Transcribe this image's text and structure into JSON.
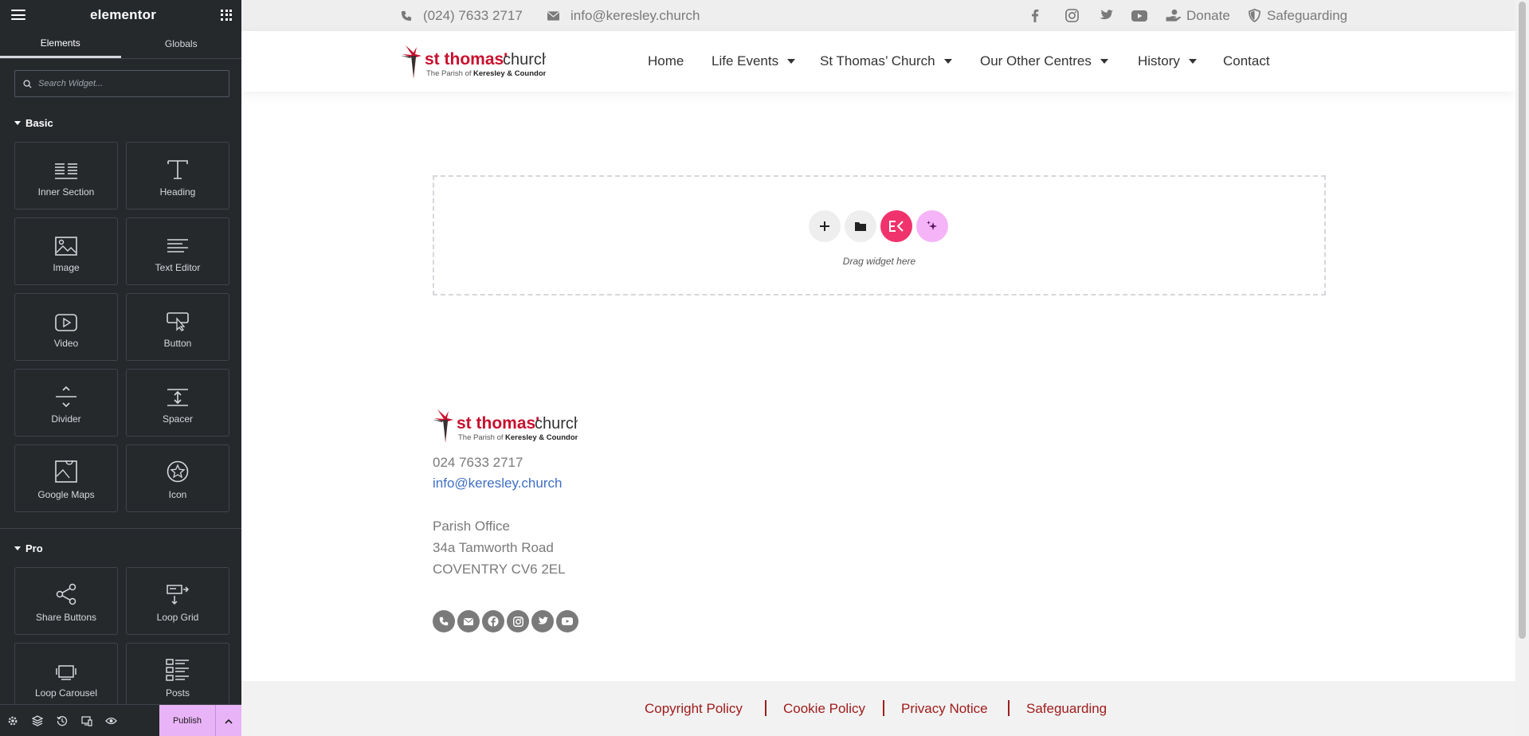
{
  "panel": {
    "brand": "elementor",
    "tabs": [
      {
        "label": "Elements",
        "active": true
      },
      {
        "label": "Globals",
        "active": false
      }
    ],
    "search": {
      "placeholder": "Search Widget..."
    },
    "categories": {
      "basic": {
        "title": "Basic",
        "widgets": [
          {
            "label": "Inner Section",
            "icon": "inner-section-icon"
          },
          {
            "label": "Heading",
            "icon": "heading-icon"
          },
          {
            "label": "Image",
            "icon": "image-icon"
          },
          {
            "label": "Text Editor",
            "icon": "text-editor-icon"
          },
          {
            "label": "Video",
            "icon": "video-icon"
          },
          {
            "label": "Button",
            "icon": "button-icon"
          },
          {
            "label": "Divider",
            "icon": "divider-icon"
          },
          {
            "label": "Spacer",
            "icon": "spacer-icon"
          },
          {
            "label": "Google Maps",
            "icon": "google-maps-icon"
          },
          {
            "label": "Icon",
            "icon": "star-icon"
          }
        ]
      },
      "pro": {
        "title": "Pro",
        "widgets": [
          {
            "label": "Share Buttons",
            "icon": "share-icon"
          },
          {
            "label": "Loop Grid",
            "icon": "loop-grid-icon"
          },
          {
            "label": "Loop Carousel",
            "icon": "loop-carousel-icon"
          },
          {
            "label": "Posts",
            "icon": "posts-icon"
          }
        ]
      }
    },
    "footer": {
      "icons": [
        "settings-icon",
        "navigator-icon",
        "history-icon",
        "responsive-icon",
        "preview-icon"
      ],
      "publish_label": "Publish"
    }
  },
  "site": {
    "topbar": {
      "phone": "(024) 7633 2717",
      "email": "info@keresley.church",
      "social": [
        "facebook-icon",
        "instagram-icon",
        "twitter-icon",
        "youtube-icon"
      ],
      "donate": "Donate",
      "safeguarding": "Safeguarding"
    },
    "logo": {
      "name_bold": "st thomas'",
      "name_light": "church",
      "tag_pre": "The Parish of",
      "tag_bold": "Keresley & Coundon",
      "colors": {
        "red": "#c8102e",
        "dark": "#333333"
      }
    },
    "nav": [
      {
        "label": "Home",
        "dropdown": false
      },
      {
        "label": "Life Events",
        "dropdown": true
      },
      {
        "label": "St Thomas’ Church",
        "dropdown": true
      },
      {
        "label": "Our Other Centres",
        "dropdown": true
      },
      {
        "label": "History",
        "dropdown": true
      },
      {
        "label": "Contact",
        "dropdown": false
      }
    ],
    "dropzone": {
      "text": "Drag widget here",
      "buttons": [
        "add-section-icon",
        "template-library-icon",
        "elementskit-icon",
        "ai-icon"
      ],
      "colors": {
        "ek": "#f0336d",
        "ai": "#f5b4f7"
      }
    },
    "footer": {
      "phone": "024 7633 2717",
      "email": "info@keresley.church",
      "office_line1": "Parish Office",
      "office_line2": "34a Tamworth Road",
      "office_line3": "COVENTRY CV6 2EL",
      "social": [
        "phone-icon",
        "envelope-icon",
        "facebook-icon",
        "instagram-icon",
        "twitter-icon",
        "youtube-icon"
      ]
    },
    "bottom_links": [
      "Copyright Policy",
      "Cookie Policy",
      "Privacy Notice",
      "Safeguarding"
    ],
    "colors": {
      "link_red": "#a01c1c",
      "link_blue": "#3f6fc4",
      "text_grey": "#7a7a7a"
    }
  }
}
